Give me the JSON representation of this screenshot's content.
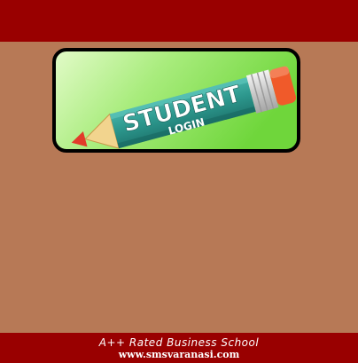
{
  "banner": {
    "title": "STUDENT",
    "subtitle": "LOGIN",
    "link_label": "Student Login",
    "icon": "pencil-icon"
  },
  "footer": {
    "tagline": "A++ Rated Business School",
    "url": "www.smsvaranasi.com"
  },
  "colors": {
    "header": "#990000",
    "background": "#b77956",
    "banner_bg_light": "#d8f7b8",
    "banner_bg_green": "#7fdc47",
    "pencil_body": "#2f9c92",
    "pencil_eraser": "#f05a2a",
    "pencil_tip": "#e23b2a"
  }
}
